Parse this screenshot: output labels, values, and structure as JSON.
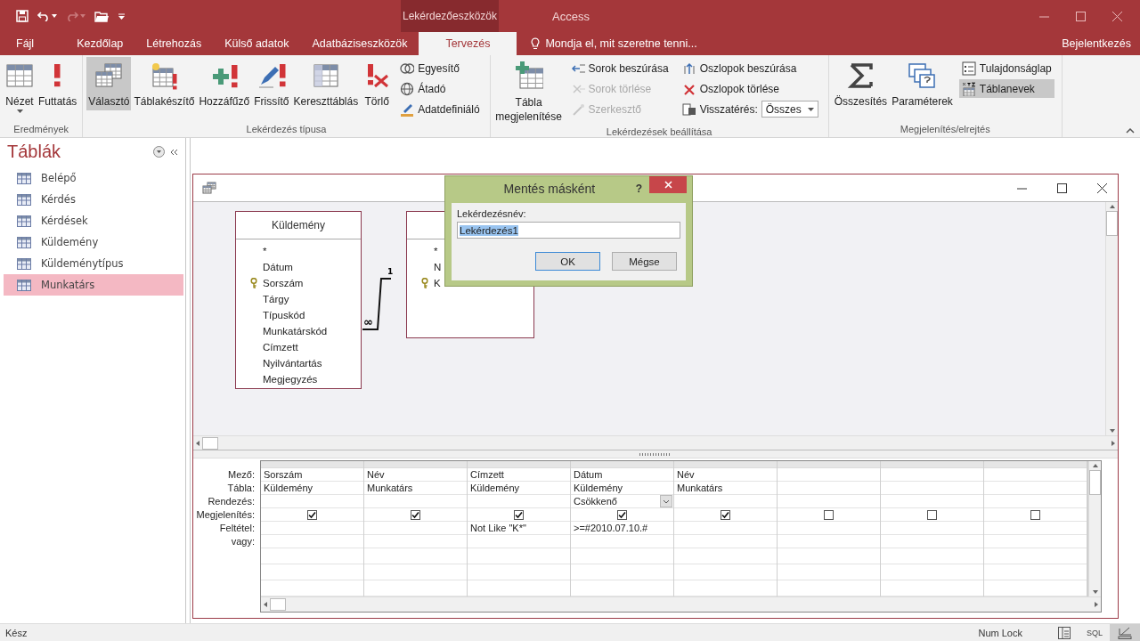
{
  "title_bar": {
    "context_tab": "Lekérdezőeszközök",
    "app": "Access"
  },
  "ribbon_tabs": [
    {
      "label": "Fájl",
      "selected": false
    },
    {
      "label": "Kezdőlap",
      "selected": false
    },
    {
      "label": "Létrehozás",
      "selected": false
    },
    {
      "label": "Külső adatok",
      "selected": false
    },
    {
      "label": "Adatbáziseszközök",
      "selected": false
    },
    {
      "label": "Tervezés",
      "selected": true
    }
  ],
  "tell_me": "Mondja el, mit szeretne tenni...",
  "sign_in": "Bejelentkezés",
  "ribbon_groups": [
    {
      "label": "Eredmények",
      "items": [
        {
          "label": "Nézet",
          "kind": "large"
        },
        {
          "label": "Futtatás",
          "kind": "large"
        }
      ]
    },
    {
      "label": "Lekérdezés típusa",
      "items": [
        {
          "label": "Választó",
          "kind": "large",
          "selected": true
        },
        {
          "label": "Táblakészítő",
          "kind": "large",
          "selected": false
        },
        {
          "label": "Hozzáfűző",
          "kind": "large",
          "selected": false
        },
        {
          "label": "Frissítő",
          "kind": "large",
          "selected": false
        },
        {
          "label": "Kereszttáblás",
          "kind": "large",
          "selected": false
        },
        {
          "label": "Törlő",
          "kind": "large",
          "selected": false
        },
        {
          "label": "Egyesítő",
          "kind": "small",
          "selected": false
        },
        {
          "label": "Átadó",
          "kind": "small",
          "selected": false
        },
        {
          "label": "Adatdefiniáló",
          "kind": "small",
          "selected": false
        }
      ]
    },
    {
      "label": "Lekérdezések beállítása",
      "items": [
        {
          "label": "Tábla megjelenítése",
          "kind": "large",
          "disabled": false
        },
        {
          "label": "Sorok beszúrása",
          "kind": "small",
          "disabled": false
        },
        {
          "label": "Sorok törlése",
          "kind": "small",
          "disabled": true
        },
        {
          "label": "Szerkesztő",
          "kind": "small",
          "disabled": true
        },
        {
          "label": "Oszlopok beszúrása",
          "kind": "small",
          "disabled": false
        },
        {
          "label": "Oszlopok törlése",
          "kind": "small",
          "disabled": false
        },
        {
          "label": "Visszatérés:",
          "kind": "dropdown",
          "value": "Összes",
          "disabled": false
        }
      ]
    },
    {
      "label": "Megjelenítés/elrejtés",
      "items": [
        {
          "label": "Összesítés",
          "kind": "large",
          "on": false
        },
        {
          "label": "Paraméterek",
          "kind": "large",
          "on": false
        },
        {
          "label": "Tulajdonságlap",
          "kind": "small",
          "on": false
        },
        {
          "label": "Táblanevek",
          "kind": "small",
          "on": true
        }
      ]
    }
  ],
  "navigation": {
    "title": "Táblák",
    "items": [
      {
        "label": "Belépő",
        "selected": false
      },
      {
        "label": "Kérdés",
        "selected": false
      },
      {
        "label": "Kérdések",
        "selected": false
      },
      {
        "label": "Küldemény",
        "selected": false
      },
      {
        "label": "Küldeménytípus",
        "selected": false
      },
      {
        "label": "Munkatárs",
        "selected": true
      }
    ]
  },
  "diagram": {
    "tables": [
      {
        "title": "Küldemény",
        "fields": [
          {
            "name": "*",
            "key": false
          },
          {
            "name": "Dátum",
            "key": false
          },
          {
            "name": "Sorszám",
            "key": true
          },
          {
            "name": "Tárgy",
            "key": false
          },
          {
            "name": "Típuskód",
            "key": false
          },
          {
            "name": "Munkatárskód",
            "key": false
          },
          {
            "name": "Címzett",
            "key": false
          },
          {
            "name": "Nyilvántartás",
            "key": false
          },
          {
            "name": "Megjegyzés",
            "key": false
          }
        ]
      },
      {
        "fields": [
          {
            "name": "*",
            "key": false
          },
          {
            "name": "N",
            "key": false
          },
          {
            "name": "K",
            "key": true
          }
        ]
      }
    ],
    "relationship": {
      "one": "1",
      "many": "∞"
    }
  },
  "grid": {
    "row_labels": [
      "Mező:",
      "Tábla:",
      "Rendezés:",
      "Megjelenítés:",
      "Feltétel:",
      "vagy:"
    ],
    "columns": [
      {
        "field": "Sorszám",
        "table": "Küldemény",
        "show": true,
        "active": false
      },
      {
        "field": "Név",
        "table": "Munkatárs",
        "show": true,
        "active": false
      },
      {
        "field": "Címzett",
        "table": "Küldemény",
        "show": true,
        "criteria": "Not Like \"K*\"",
        "active": false
      },
      {
        "field": "Dátum",
        "table": "Küldemény",
        "sort": "Csökkenő",
        "show": true,
        "criteria": ">=#2010.07.10.#",
        "active": true
      },
      {
        "field": "Név",
        "table": "Munkatárs",
        "show": true,
        "active": false
      },
      {
        "show": false,
        "active": false
      },
      {
        "show": false,
        "active": false
      },
      {
        "show": false,
        "active": false
      }
    ]
  },
  "dialog": {
    "title": "Mentés másként",
    "help": "?",
    "label": "Lekérdezésnév:",
    "value": "Lekérdezés1",
    "value_selected": true,
    "buttons": [
      "OK",
      "Mégse"
    ]
  },
  "status_bar": {
    "text": "Kész",
    "num_lock": "Num Lock",
    "views": [
      {
        "kind": "datasheet",
        "selected": false
      },
      {
        "kind": "sql",
        "label": "SQL",
        "selected": false
      },
      {
        "kind": "design",
        "selected": true
      }
    ]
  }
}
